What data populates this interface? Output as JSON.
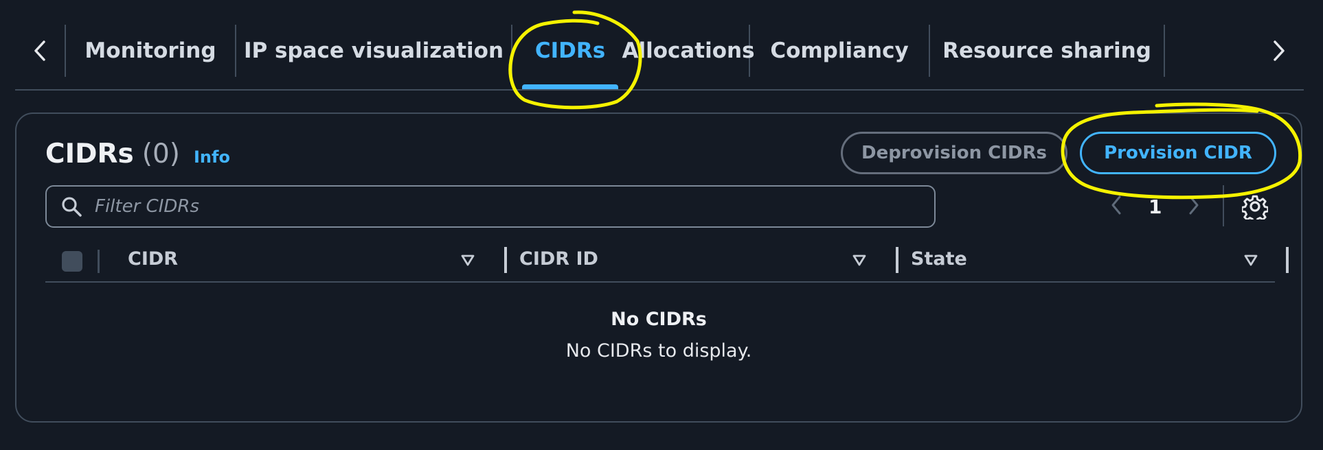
{
  "tabs": {
    "items": [
      {
        "label": "Monitoring"
      },
      {
        "label": "IP space visualization"
      },
      {
        "label": "CIDRs",
        "active": true
      },
      {
        "label": "Allocations"
      },
      {
        "label": "Compliancy"
      },
      {
        "label": "Resource sharing"
      }
    ],
    "prev_icon": "chevron-left-icon",
    "next_icon": "chevron-right-icon"
  },
  "panel": {
    "title": "CIDRs",
    "count": "(0)",
    "info_link": "Info",
    "deprovision_label": "Deprovision CIDRs",
    "provision_label": "Provision CIDR",
    "filter_placeholder": "Filter CIDRs",
    "filter_value": "",
    "pagination": {
      "current_page": "1"
    },
    "table": {
      "columns": [
        "CIDR",
        "CIDR ID",
        "State"
      ]
    },
    "empty": {
      "title": "No CIDRs",
      "description": "No CIDRs to display."
    }
  },
  "colors": {
    "background": "#141a24",
    "accent": "#42b4ff",
    "border": "#414d5c",
    "annotation": "#f5f200"
  }
}
